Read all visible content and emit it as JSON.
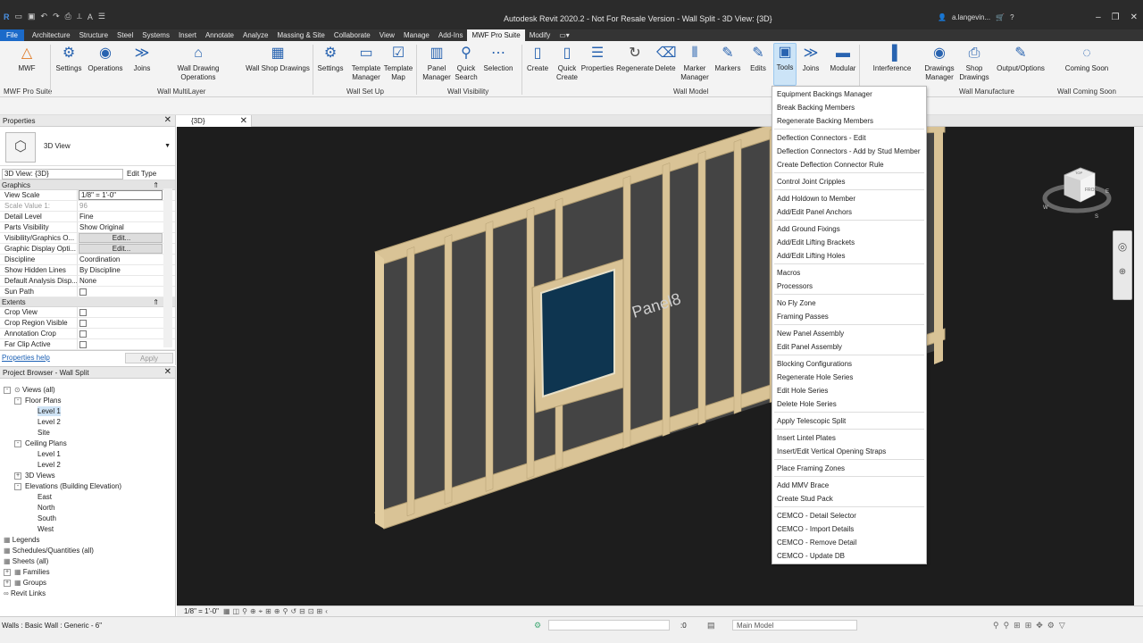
{
  "titlebar": {
    "title": "Autodesk Revit 2020.2 - Not For Resale Version - Wall Split - 3D View: {3D}",
    "user": "a.langevin..."
  },
  "tabs": [
    "File",
    "Architecture",
    "Structure",
    "Steel",
    "Systems",
    "Insert",
    "Annotate",
    "Analyze",
    "Massing & Site",
    "Collaborate",
    "View",
    "Manage",
    "Add-Ins",
    "MWF Pro Suite",
    "Modify"
  ],
  "ribbon": {
    "buttons": [
      {
        "label": "MWF"
      },
      {
        "label": "Settings"
      },
      {
        "label": "Operations"
      },
      {
        "label": "Joins"
      },
      {
        "label": "Wall Drawing Operations"
      },
      {
        "label": "Wall Shop Drawings"
      },
      {
        "label": "Settings"
      },
      {
        "label": "Template Manager"
      },
      {
        "label": "Template Map"
      },
      {
        "label": "Panel Manager"
      },
      {
        "label": "Quick Search"
      },
      {
        "label": "Selection"
      },
      {
        "label": "Create"
      },
      {
        "label": "Quick Create"
      },
      {
        "label": "Properties"
      },
      {
        "label": "Regenerate"
      },
      {
        "label": "Delete"
      },
      {
        "label": "Marker Manager"
      },
      {
        "label": "Markers"
      },
      {
        "label": "Edits"
      },
      {
        "label": "Tools"
      },
      {
        "label": "Joins"
      },
      {
        "label": "Modular"
      },
      {
        "label": "Interference"
      },
      {
        "label": "Drawings Manager"
      },
      {
        "label": "Shop Drawings"
      },
      {
        "label": "Output/Options"
      },
      {
        "label": "Coming Soon"
      }
    ],
    "panels": [
      "MWF Pro Suite",
      "Wall MultiLayer",
      "Wall Set Up",
      "Wall Visibility",
      "Wall Model",
      "Wall Manufacture",
      "Wall Coming Soon"
    ]
  },
  "properties": {
    "title": "Properties",
    "type_name": "3D View",
    "instance": "3D View: {3D}",
    "edit_type": "Edit Type",
    "cat_graphics": "Graphics",
    "rows": [
      {
        "k": "View Scale",
        "v": "1/8\" = 1'-0\""
      },
      {
        "k": "Scale Value    1:",
        "v": "96"
      },
      {
        "k": "Detail Level",
        "v": "Fine"
      },
      {
        "k": "Parts Visibility",
        "v": "Show Original"
      },
      {
        "k": "Visibility/Graphics O...",
        "v": "Edit..."
      },
      {
        "k": "Graphic Display Opti...",
        "v": "Edit..."
      },
      {
        "k": "Discipline",
        "v": "Coordination"
      },
      {
        "k": "Show Hidden Lines",
        "v": "By Discipline"
      },
      {
        "k": "Default Analysis Disp...",
        "v": "None"
      },
      {
        "k": "Sun Path",
        "v": ""
      }
    ],
    "cat_extents": "Extents",
    "rows2": [
      {
        "k": "Crop View"
      },
      {
        "k": "Crop Region Visible"
      },
      {
        "k": "Annotation Crop"
      },
      {
        "k": "Far Clip Active"
      }
    ],
    "help": "Properties help",
    "apply": "Apply"
  },
  "browser": {
    "title": "Project Browser - Wall Split",
    "nodes": [
      "Views (all)",
      "Floor Plans",
      "Level 1",
      "Level 2",
      "Site",
      "Ceiling Plans",
      "Level 1",
      "Level 2",
      "3D Views",
      "Elevations (Building Elevation)",
      "East",
      "North",
      "South",
      "West",
      "Legends",
      "Schedules/Quantities (all)",
      "Sheets (all)",
      "Families",
      "Groups",
      "Revit Links"
    ]
  },
  "view": {
    "tab": "{3D}",
    "panel_label": "Panel8",
    "scale": "1/8\" = 1'-0\""
  },
  "viewcube": {
    "face": "FRONT",
    "top": "TOP",
    "compass": {
      "w": "W",
      "s": "S",
      "e": "E"
    }
  },
  "menu": {
    "items": [
      "Equipment Backings Manager",
      "Break Backing Members",
      "Regenerate Backing Members",
      "Deflection Connectors - Edit",
      "Deflection Connectors - Add by Stud Member",
      "Create Deflection Connector Rule",
      "Control Joint Cripples",
      "Add Holdown to Member",
      "Add/Edit Panel Anchors",
      "Add Ground Fixings",
      "Add/Edit Lifting Brackets",
      "Add/Edit Lifting Holes",
      "Macros",
      "Processors",
      "No Fly Zone",
      "Framing Passes",
      "New Panel Assembly",
      "Edit Panel Assembly",
      "Blocking Configurations",
      "Regenerate Hole Series",
      "Edit Hole Series",
      "Delete Hole Series",
      "Apply Telescopic Split",
      "Insert Lintel Plates",
      "Insert/Edit Vertical Opening Straps",
      "Place Framing Zones",
      "Add MMV Brace",
      "Create Stud Pack",
      "CEMCO - Detail Selector",
      "CEMCO - Import Details",
      "CEMCO - Remove Detail",
      "CEMCO - Update DB"
    ]
  },
  "status": {
    "text": "Walls : Basic Wall : Generic - 6\"",
    "zero": ":0",
    "model": "Main Model"
  }
}
